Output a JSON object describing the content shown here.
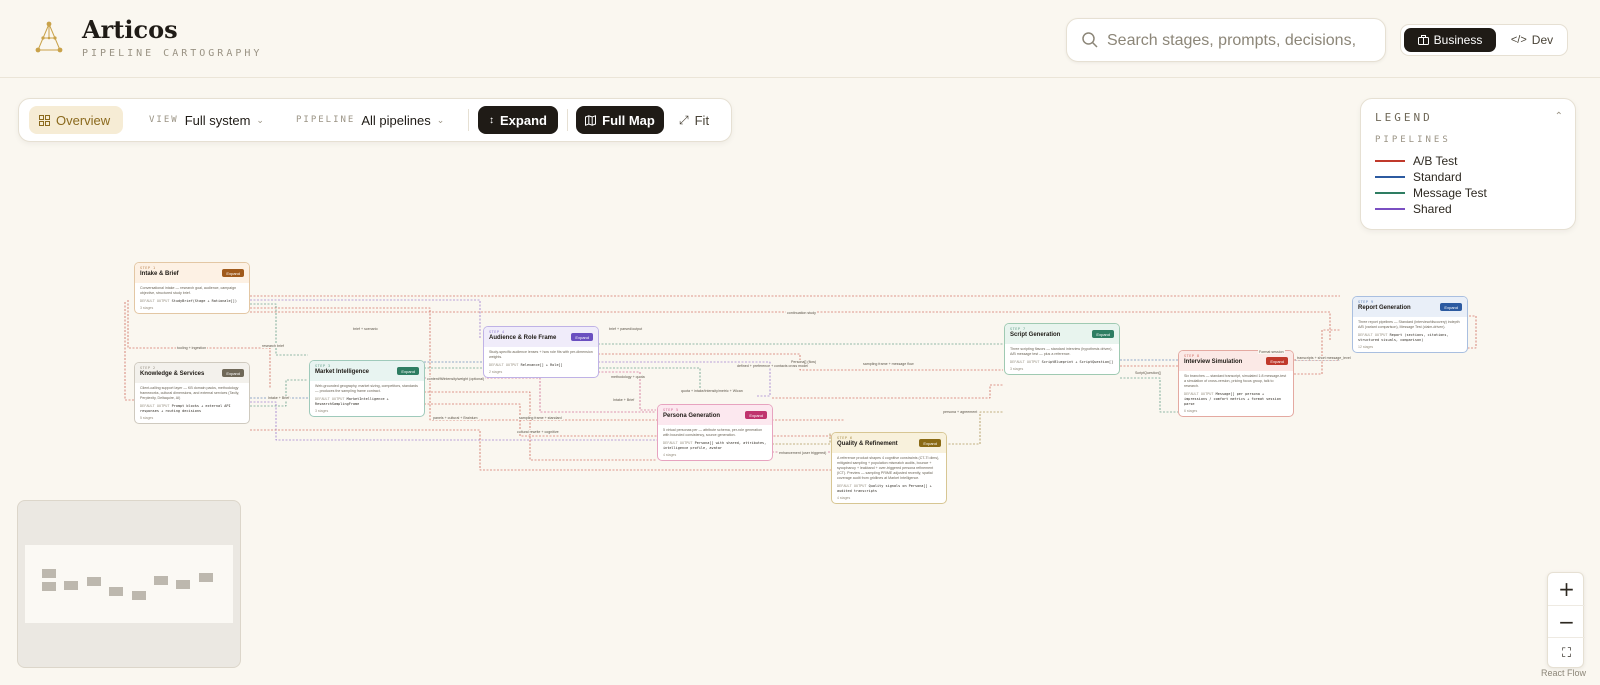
{
  "brand": {
    "title": "Articos",
    "subtitle": "PIPELINE CARTOGRAPHY",
    "logo_icon": "constellation-logo"
  },
  "search": {
    "placeholder": "Search stages, prompts, decisions,"
  },
  "modes": {
    "active": "Business",
    "inactive": "Dev"
  },
  "toolbar": {
    "overview": "Overview",
    "view_label": "VIEW",
    "view_value": "Full system",
    "pipeline_label": "PIPELINE",
    "pipeline_value": "All pipelines",
    "expand": "Expand",
    "full_map": "Full Map",
    "fit": "Fit"
  },
  "legend": {
    "title": "LEGEND",
    "subtitle": "PIPELINES",
    "items": [
      {
        "label": "A/B Test",
        "color": "#c0392b"
      },
      {
        "label": "Standard",
        "color": "#2c5aa0"
      },
      {
        "label": "Message Test",
        "color": "#2e7d62"
      },
      {
        "label": "Shared",
        "color": "#7a4fc2"
      }
    ]
  },
  "nodes": [
    {
      "step": "STEP 1",
      "title": "Intake & Brief",
      "button": "Expand",
      "color": "#a05a1c",
      "tint": "#fdf1e4",
      "border": "#e3c7a4",
      "desc": "Conversational intake — research goal, audience, campaign objective, structured study brief.",
      "code_label": "DEFAULT OUTPUT",
      "code": "StudyBrief(Stage + Rationale[])",
      "foot": "3 stages"
    },
    {
      "step": "STEP 2",
      "title": "Knowledge & Services",
      "button": "Expand",
      "color": "#6f6858",
      "tint": "#f3f1ec",
      "border": "#cfcabf",
      "desc": "Client-calling support layer — KB domain packs, methodology frameworks, cultural dimensions, and external services (Tavily, Perplexity, Deltaquire, AI)",
      "code_label": "DEFAULT OUTPUT",
      "code": "Prompt blocks + external API responses + routing decisions",
      "foot": "5 stages"
    },
    {
      "step": "STEP 3",
      "title": "Market Intelligence",
      "button": "Expand",
      "color": "#2e7d62",
      "tint": "#e8f4f1",
      "border": "#9fcabb",
      "desc": "Web-grounded geography, market sizing, competitors, standards — produces the sampling frame contract.",
      "code_label": "DEFAULT OUTPUT",
      "code": "MarketIntelligence + ResearchSamplingFrame",
      "foot": "3 stages"
    },
    {
      "step": "STEP 4",
      "title": "Audience & Role Frame",
      "button": "Expand",
      "color": "#6a4fc0",
      "tint": "#f0ecfa",
      "border": "#bfb2e6",
      "desc": "Study-specific audience lenses + how role fits with per-dimension weights.",
      "code_label": "DEFAULT OUTPUT",
      "code": "Relevance[] + Role[]",
      "foot": "2 stages"
    },
    {
      "step": "STEP 5",
      "title": "Persona Generation",
      "button": "Expand",
      "color": "#c0336e",
      "tint": "#fce8ef",
      "border": "#e7a3bf",
      "desc": "5 virtual personas per — attribute schema, per-role generation with bounded consistency, source generation.",
      "code_label": "DEFAULT OUTPUT",
      "code": "Persona[] with shared, attributes, intelligence profile, avatar",
      "foot": "4 stages"
    },
    {
      "step": "STEP 6",
      "title": "Quality & Refinement",
      "button": "Expand",
      "color": "#8a6a14",
      "tint": "#f8f1dc",
      "border": "#d7c693",
      "desc": "A reference product shapes 4 cognitive constraints (CT-Tl dims), mitigated sampling + population mismatch audits, bounce + sycophancy + leakband + over-triggered persona refinement (ICT). Preview — sampling PRIME adjusted recently, spatial coverage audit from gridlines at Market Intelligence.",
      "code_label": "DEFAULT OUTPUT",
      "code": "Quality signals on Persona[] + audited transcripts",
      "foot": "4 stages"
    },
    {
      "step": "STEP 7",
      "title": "Script Generation",
      "button": "Expand",
      "color": "#2e7d62",
      "tint": "#e8f4ee",
      "border": "#9fcab2",
      "desc": "Three scripting flavors — standard interview (hypothesis driven), A/B message test — plus a reference.",
      "code_label": "DEFAULT OUTPUT",
      "code": "ScriptBlueprint + ScriptQuestion[]",
      "foot": "3 stages"
    },
    {
      "step": "STEP 8",
      "title": "Interview Simulation",
      "button": "Expand",
      "color": "#c0392b",
      "tint": "#fbe9e6",
      "border": "#e4a9a1",
      "desc": "Six branches — standard transcript, simulated 1:8 message-test a simulation of cross-version, pricing focus group, talk to research.",
      "code_label": "DEFAULT OUTPUT",
      "code": "Message[] per persona + impressions / comfort metrics + format session parse",
      "foot": "6 stages"
    },
    {
      "step": "STEP 9",
      "title": "Report Generation",
      "button": "Expand",
      "color": "#2c5aa0",
      "tint": "#e9eff8",
      "border": "#a9bfe0",
      "desc": "Three report pipelines — Standard (interview/discovery) indepth A/B (variant comparison), Message Test (claim-driven).",
      "code_label": "DEFAULT OUTPUT",
      "code": "Report (sections, citations, structured visuals, comparison)",
      "foot": "12 stages"
    }
  ],
  "edge_labels": [
    "tooling + ingestion",
    "brief + scenario",
    "research brief",
    "Intake + Brief",
    "content/fit/intensity/weight (optional)",
    "brief + parsed/output",
    "continuation study",
    "methodology + quota",
    "Intake + Brief",
    "quota + intake/intensity/metric + Wlcan",
    "sampling frame + standard",
    "cultural rewrite + cognitive",
    "panels + cultural + Brainlum",
    "Persona[] (flow)",
    "persona + agreement",
    "defined + preference + contacts cross model",
    "sampling frame + message flow",
    "ScriptQuestion[]",
    "enhancement (user triggered)",
    "Format session",
    "transcripts + short message_level"
  ],
  "zoom": {
    "in_icon": "plus-icon",
    "out_icon": "minus-icon",
    "fit_icon": "fit-view-icon"
  },
  "attribution": "React Flow"
}
